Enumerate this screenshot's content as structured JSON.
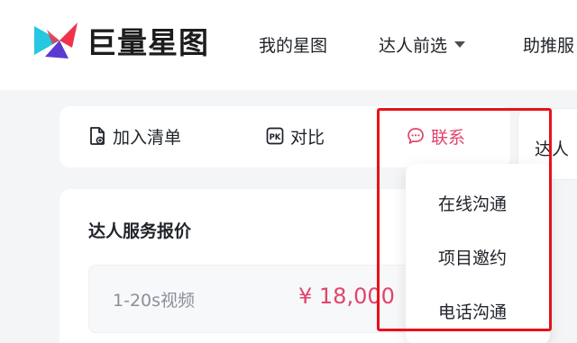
{
  "header": {
    "logo_text": "巨量星图",
    "nav": [
      {
        "label": "我的星图"
      },
      {
        "label": "达人前选",
        "has_dropdown": true
      },
      {
        "label": "助推服"
      }
    ]
  },
  "actions": {
    "add_to_list": "加入清单",
    "compare": "对比",
    "contact": "联系"
  },
  "side_card": {
    "label": "达人"
  },
  "pricing": {
    "title": "达人服务报价",
    "rows": [
      {
        "label": "1-20s视频",
        "price": "¥ 18,000"
      }
    ]
  },
  "contact_menu": {
    "items": [
      "在线沟通",
      "项目邀约",
      "电话沟通"
    ]
  },
  "colors": {
    "accent": "#e0446b",
    "highlight_border": "#e8111a",
    "logo_red": "#f0334a",
    "logo_cyan": "#26c7e0",
    "logo_purple": "#5a3ad1"
  }
}
